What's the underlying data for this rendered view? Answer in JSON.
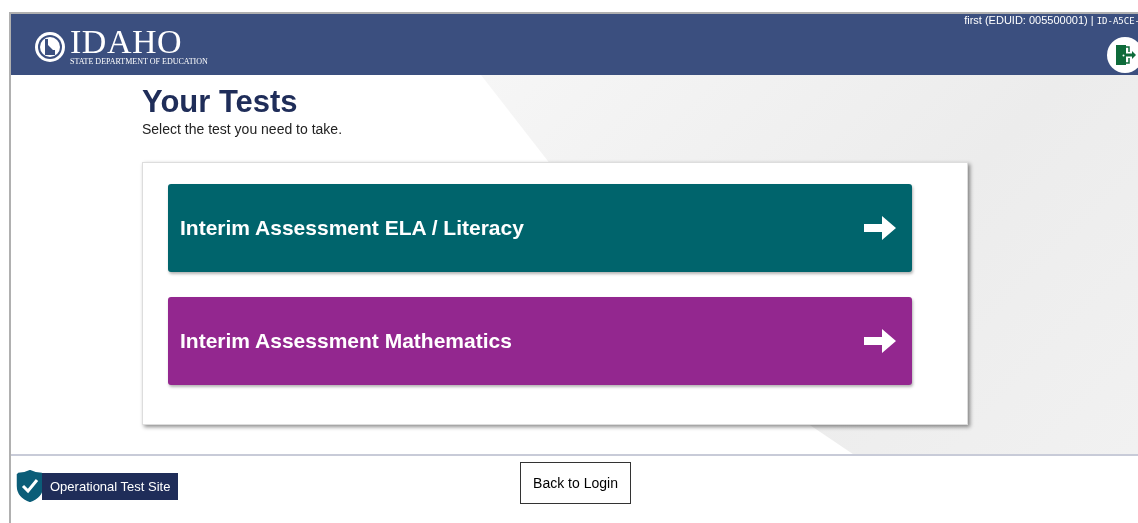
{
  "header": {
    "logo_word": "IDAHO",
    "logo_subtitle": "STATE DEPARTMENT OF EDUCATION",
    "user": "first (EDUID: 005500001) |",
    "session_id": "ID-A5CE-"
  },
  "main": {
    "title": "Your Tests",
    "instruction": "Select the test you need to take.",
    "tests": [
      {
        "label": "Interim Assessment ELA / Literacy",
        "color": "#00646c"
      },
      {
        "label": "Interim Assessment Mathematics",
        "color": "#93278f"
      }
    ]
  },
  "footer": {
    "site_badge": "Operational Test Site",
    "back_button": "Back to Login"
  }
}
